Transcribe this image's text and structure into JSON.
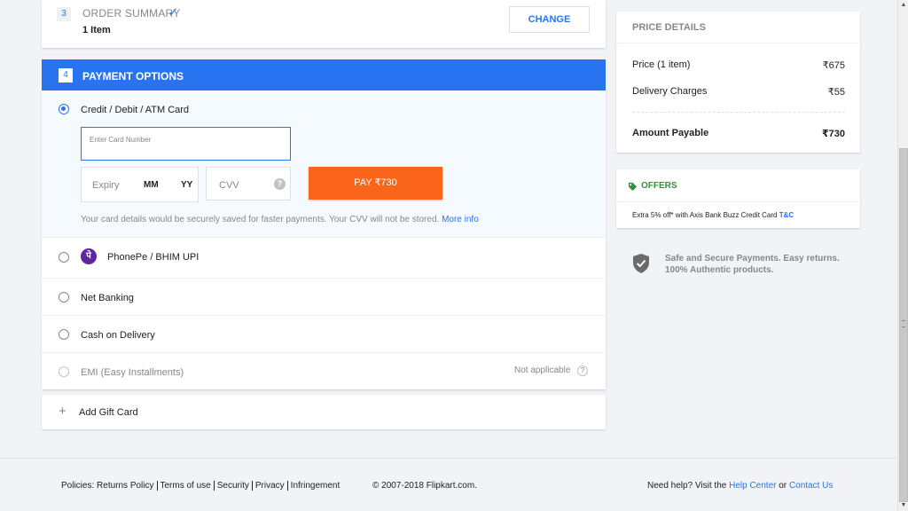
{
  "order_summary": {
    "step": "3",
    "title": "ORDER SUMMARY",
    "items": "1 Item",
    "change_label": "CHANGE"
  },
  "payment": {
    "step": "4",
    "title": "PAYMENT OPTIONS",
    "card_option": "Credit / Debit / ATM Card",
    "card_number_placeholder": "Enter Card Number",
    "expiry_label": "Expiry",
    "expiry_month": "MM",
    "expiry_year": "YY",
    "cvv_label": "CVV",
    "cvv_help": "?",
    "pay_button": "PAY ₹730",
    "secure_note": "Your card details would be securely saved for faster payments. Your CVV will not be stored.",
    "more_info": "More info",
    "phonepe_option": "PhonePe / BHIM UPI",
    "phonepe_glyph": "पे",
    "netbanking_option": "Net Banking",
    "cod_option": "Cash on Delivery",
    "emi_option": "EMI (Easy Installments)",
    "emi_status": "Not applicable",
    "emi_help": "?"
  },
  "gift_card": {
    "label": "Add Gift Card"
  },
  "price_details": {
    "title": "PRICE DETAILS",
    "price_label": "Price (1 item)",
    "price_value": "₹675",
    "delivery_label": "Delivery Charges",
    "delivery_value": "₹55",
    "total_label": "Amount Payable",
    "total_value": "₹730"
  },
  "offers": {
    "title": "OFFERS",
    "offer_text": "Extra 5% off* with Axis Bank Buzz Credit Card",
    "tnc": "T&C"
  },
  "safe": {
    "text": "Safe and Secure Payments. Easy returns. 100% Authentic products."
  },
  "footer": {
    "policies_label": "Policies:",
    "links": [
      "Returns Policy",
      "Terms of use",
      "Security",
      "Privacy",
      "Infringement"
    ],
    "copyright": "© 2007-2018 Flipkart.com.",
    "help_prefix": "Need help? Visit the",
    "help_center": "Help Center",
    "or": "or",
    "contact_us": "Contact Us"
  },
  "colors": {
    "primary": "#2874f0",
    "pay_button": "#fb641b",
    "offers_green": "#388e3c",
    "background": "#f1f3f6"
  }
}
